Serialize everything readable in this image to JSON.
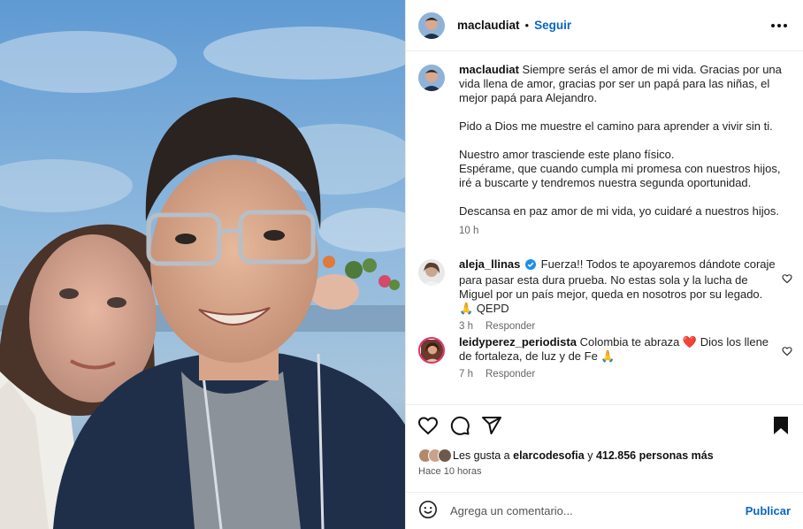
{
  "post": {
    "username": "maclaudiat",
    "dot": "•",
    "follow_label": "Seguir"
  },
  "caption": {
    "username": "maclaudiat",
    "paragraphs": [
      "Siempre serás el amor de mi vida. Gracias por una vida llena de amor, gracias por ser un papá para las niñas, el mejor papá para Alejandro.",
      "Pido a Dios me muestre el camino para aprender a vivir sin ti.",
      "Nuestro amor trasciende este plano físico.",
      "Espérame, que cuando cumpla mi promesa con nuestros hijos, iré a buscarte y tendremos nuestra segunda oportunidad.",
      "Descansa en paz amor de mi vida, yo cuidaré a nuestros hijos."
    ],
    "time": "10 h"
  },
  "comments": [
    {
      "username": "aleja_llinas",
      "verified": true,
      "text": "Fuerza!! Todos te apoyaremos dándote coraje para pasar esta dura prueba. No estas sola y la lucha de Miguel por un país mejor, queda en nosotros por su legado. 🙏 QEPD",
      "time": "3 h",
      "reply_label": "Responder"
    },
    {
      "username": "leidyperez_periodista",
      "verified": false,
      "text": "Colombia te abraza ❤️ Dios los llene de fortaleza, de luz y de Fe 🙏",
      "time": "7 h",
      "reply_label": "Responder"
    }
  ],
  "likes": {
    "prefix": "Les gusta a",
    "user": "elarcodesofia",
    "suffix": "y",
    "count": "412.856 personas más"
  },
  "posted_time": "Hace 10 horas",
  "composer": {
    "placeholder": "Agrega un comentario...",
    "post_label": "Publicar"
  },
  "icons": {
    "like": "heart-icon",
    "comment": "comment-icon",
    "share": "share-icon",
    "save": "bookmark-icon",
    "more": "more-icon",
    "emoji": "emoji-icon"
  },
  "colors": {
    "accent": "#0a66c2",
    "verified": "#1d8fe8",
    "like_red": "#d11f2f"
  }
}
